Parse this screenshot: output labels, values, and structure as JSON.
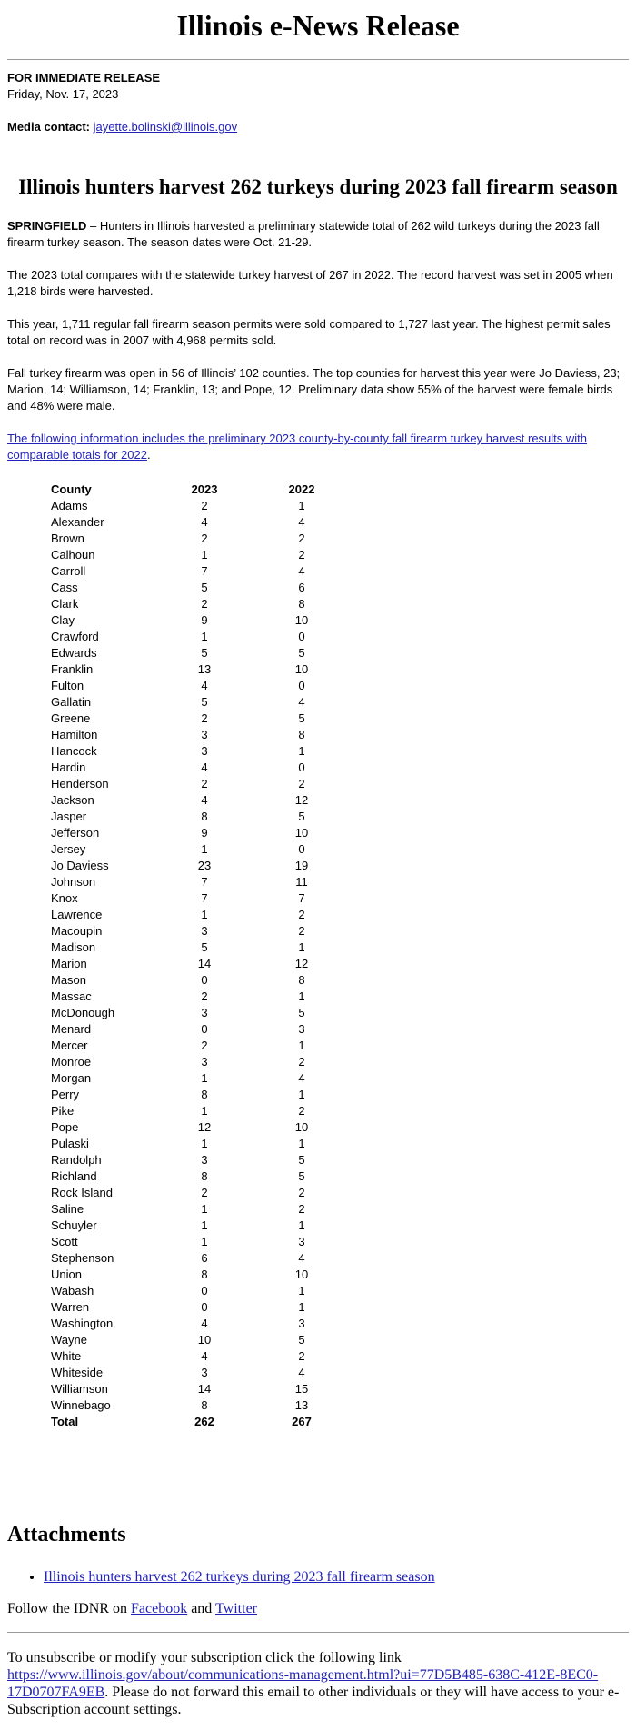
{
  "header": {
    "masthead": "Illinois e-News Release",
    "release_label": "FOR IMMEDIATE RELEASE",
    "date": "Friday, Nov. 17, 2023",
    "contact_label": "Media contact:",
    "contact_email": "jayette.bolinski@illinois.gov"
  },
  "article": {
    "headline": "Illinois hunters harvest 262 turkeys during 2023 fall firearm season",
    "dateline": "SPRINGFIELD",
    "para1": " – Hunters in Illinois harvested a preliminary statewide total of 262 wild turkeys during the 2023 fall firearm turkey season. The season dates were Oct. 21-29.",
    "para2": "The 2023 total compares with the statewide turkey harvest of 267 in 2022. The record harvest was set in 2005 when 1,218 birds were harvested.",
    "para3": "This year, 1,711 regular fall firearm season permits were sold compared to 1,727 last year. The highest permit sales total on record was in 2007 with 4,968 permits sold.",
    "para4": "Fall turkey firearm was open in 56 of Illinois’ 102 counties. The top counties for harvest this year were Jo Daviess, 23; Marion, 14; Williamson, 14; Franklin, 13; and Pope, 12. Preliminary data show 55% of the harvest were female birds and 48% were male.",
    "intro_link": "The following information includes the preliminary 2023 county-by-county fall firearm turkey harvest results with comparable totals for 2022",
    "intro_tail": "."
  },
  "table": {
    "headers": [
      "County",
      "2023",
      "2022"
    ],
    "rows": [
      [
        "Adams",
        "2",
        "1"
      ],
      [
        "Alexander",
        "4",
        "4"
      ],
      [
        "Brown",
        "2",
        "2"
      ],
      [
        "Calhoun",
        "1",
        "2"
      ],
      [
        "Carroll",
        "7",
        "4"
      ],
      [
        "Cass",
        "5",
        "6"
      ],
      [
        "Clark",
        "2",
        "8"
      ],
      [
        "Clay",
        "9",
        "10"
      ],
      [
        "Crawford",
        "1",
        "0"
      ],
      [
        "Edwards",
        "5",
        "5"
      ],
      [
        "Franklin",
        "13",
        "10"
      ],
      [
        "Fulton",
        "4",
        "0"
      ],
      [
        "Gallatin",
        "5",
        "4"
      ],
      [
        "Greene",
        "2",
        "5"
      ],
      [
        "Hamilton",
        "3",
        "8"
      ],
      [
        "Hancock",
        "3",
        "1"
      ],
      [
        "Hardin",
        "4",
        "0"
      ],
      [
        "Henderson",
        "2",
        "2"
      ],
      [
        "Jackson",
        "4",
        "12"
      ],
      [
        "Jasper",
        "8",
        "5"
      ],
      [
        "Jefferson",
        "9",
        "10"
      ],
      [
        "Jersey",
        "1",
        "0"
      ],
      [
        "Jo Daviess",
        "23",
        "19"
      ],
      [
        "Johnson",
        "7",
        "11"
      ],
      [
        "Knox",
        "7",
        "7"
      ],
      [
        "Lawrence",
        "1",
        "2"
      ],
      [
        "Macoupin",
        "3",
        "2"
      ],
      [
        "Madison",
        "5",
        "1"
      ],
      [
        "Marion",
        "14",
        "12"
      ],
      [
        "Mason",
        "0",
        "8"
      ],
      [
        "Massac",
        "2",
        "1"
      ],
      [
        "McDonough",
        "3",
        "5"
      ],
      [
        "Menard",
        "0",
        "3"
      ],
      [
        "Mercer",
        "2",
        "1"
      ],
      [
        "Monroe",
        "3",
        "2"
      ],
      [
        "Morgan",
        "1",
        "4"
      ],
      [
        "Perry",
        "8",
        "1"
      ],
      [
        "Pike",
        "1",
        "2"
      ],
      [
        "Pope",
        "12",
        "10"
      ],
      [
        "Pulaski",
        "1",
        "1"
      ],
      [
        "Randolph",
        "3",
        "5"
      ],
      [
        "Richland",
        "8",
        "5"
      ],
      [
        "Rock Island",
        "2",
        "2"
      ],
      [
        "Saline",
        "1",
        "2"
      ],
      [
        "Schuyler",
        "1",
        "1"
      ],
      [
        "Scott",
        "1",
        "3"
      ],
      [
        "Stephenson",
        "6",
        "4"
      ],
      [
        "Union",
        "8",
        "10"
      ],
      [
        "Wabash",
        "0",
        "1"
      ],
      [
        "Warren",
        "0",
        "1"
      ],
      [
        "Washington",
        "4",
        "3"
      ],
      [
        "Wayne",
        "10",
        "5"
      ],
      [
        "White",
        "4",
        "2"
      ],
      [
        "Whiteside",
        "3",
        "4"
      ],
      [
        "Williamson",
        "14",
        "15"
      ],
      [
        "Winnebago",
        "8",
        "13"
      ]
    ],
    "total": [
      "Total",
      "262",
      "267"
    ]
  },
  "footer": {
    "attachments_title": "Attachments",
    "attachment_link": "Illinois hunters harvest 262 turkeys during 2023 fall firearm season",
    "follow_prefix": "Follow the IDNR on ",
    "facebook": "Facebook",
    "follow_and": " and ",
    "twitter": "Twitter",
    "unsub_prefix": "To unsubscribe or modify your subscription click the following link ",
    "unsub_link": "https://www.illinois.gov/about/communications-management.html?ui=77D5B485-638C-412E-8EC0-17D0707FA9EB",
    "unsub_suffix": ". Please do not forward this email to other individuals or they will have access to your e-Subscription account settings."
  }
}
